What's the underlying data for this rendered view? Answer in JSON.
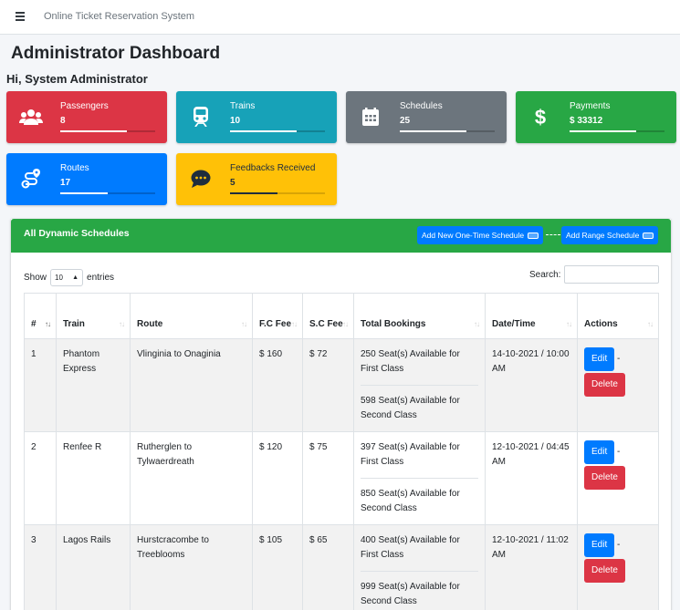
{
  "app": {
    "title": "Online Ticket Reservation System"
  },
  "page": {
    "title": "Administrator Dashboard",
    "greeting": "Hi, System Administrator"
  },
  "stats": [
    {
      "label": "Passengers",
      "value": "8",
      "icon": "users-icon",
      "color": "#dc3545",
      "progress": 0.7
    },
    {
      "label": "Trains",
      "value": "10",
      "icon": "train-icon",
      "color": "#17a2b8",
      "progress": 0.7
    },
    {
      "label": "Schedules",
      "value": "25",
      "icon": "calendar-icon",
      "color": "#6c757d",
      "progress": 0.7
    },
    {
      "label": "Payments",
      "value": "$ 33312",
      "icon": "dollar-icon",
      "color": "#28a745",
      "progress": 0.7
    },
    {
      "label": "Routes",
      "value": "17",
      "icon": "route-icon",
      "color": "#007bff",
      "progress": 0.5
    },
    {
      "label": "Feedbacks Received",
      "value": "5",
      "icon": "comment-icon",
      "color": "#ffc107",
      "progress": 0.5
    }
  ],
  "schedules": {
    "title": "All Dynamic Schedules",
    "add_one_time": "Add New One-Time Schedule",
    "add_range": "Add Range Schedule",
    "show_label": "Show",
    "entries_value": "10",
    "entries_label": "entries",
    "search_label": "Search:",
    "columns": [
      "#",
      "Train",
      "Route",
      "F.C Fee",
      "S.C Fee",
      "Total Bookings",
      "Date/Time",
      "Actions"
    ],
    "edit_label": "Edit",
    "delete_label": "Delete",
    "rows": [
      {
        "num": "1",
        "train": "Phantom Express",
        "route": "Vlinginia to Onaginia",
        "fc": "$ 160",
        "sc": "$ 72",
        "first": "250 Seat(s) Available for First Class",
        "second": "598 Seat(s) Available for Second Class",
        "datetime": "14-10-2021 / 10:00 AM"
      },
      {
        "num": "2",
        "train": "Renfee R",
        "route": "Rutherglen to Tylwaerdreath",
        "fc": "$ 120",
        "sc": "$ 75",
        "first": "397 Seat(s) Available for First Class",
        "second": "850 Seat(s) Available for Second Class",
        "datetime": "12-10-2021 / 04:45 AM"
      },
      {
        "num": "3",
        "train": "Lagos Rails",
        "route": "Hurstcracombe to Treeblooms",
        "fc": "$ 105",
        "sc": "$ 65",
        "first": "400 Seat(s) Available for First Class",
        "second": "999 Seat(s) Available for Second Class",
        "datetime": "12-10-2021 / 11:02 AM"
      }
    ]
  }
}
